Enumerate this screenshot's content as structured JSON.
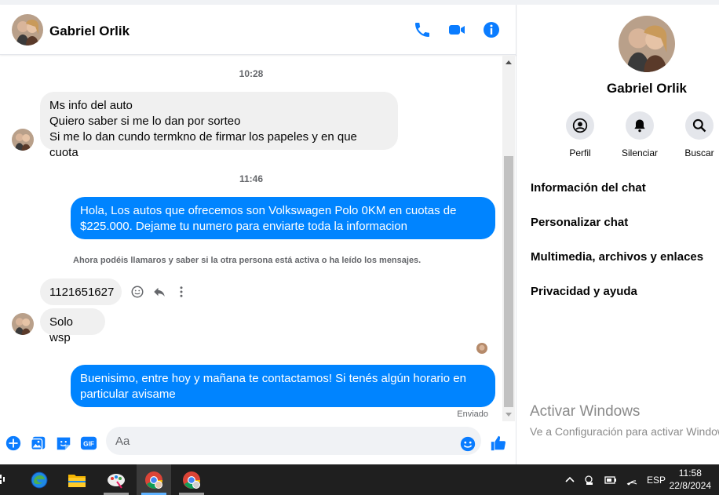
{
  "header": {
    "contact_name": "Gabriel Orlik"
  },
  "messages": {
    "time_1": "10:28",
    "in_1_lines": [
      "Ms info del auto",
      "Quiero saber si me lo dan por sorteo",
      "Si me lo dan cundo termkno de firmar los papeles y en que cuota"
    ],
    "time_2": "11:46",
    "out_1_lines": [
      "Hola, Los autos que ofrecemos son Volkswagen Polo 0KM en cuotas de",
      "$225.000. Dejame tu numero para enviarte toda la informacion"
    ],
    "notice": "Ahora podéis llamaros y saber si la otra persona está activa o ha leído los mensajes.",
    "in_2": "1121651627",
    "in_3": "Solo wsp",
    "out_2_lines": [
      "Buenisimo, entre hoy y mañana te contactamos! Si tenés algún horario en",
      "particular avisame"
    ],
    "status": "Enviado"
  },
  "composer": {
    "placeholder": "Aa",
    "gif_label": "GIF"
  },
  "panel": {
    "name": "Gabriel Orlik",
    "actions": [
      {
        "label": "Perfil",
        "icon": "profile-icon"
      },
      {
        "label": "Silenciar",
        "icon": "bell-icon"
      },
      {
        "label": "Buscar",
        "icon": "search-icon"
      }
    ],
    "menu": [
      "Información del chat",
      "Personalizar chat",
      "Multimedia, archivos y enlaces",
      "Privacidad y ayuda"
    ]
  },
  "watermark": {
    "line1": "Activar Windows",
    "line2": "Ve a Configuración para activar Windows."
  },
  "taskbar": {
    "lang": "ESP",
    "time": "11:58",
    "date": "22/8/2024"
  },
  "colors": {
    "accent": "#0084ff",
    "icon_blue": "#0a7cff",
    "bubble_in": "#f0f0f0",
    "taskbar": "#1f1f1f"
  }
}
